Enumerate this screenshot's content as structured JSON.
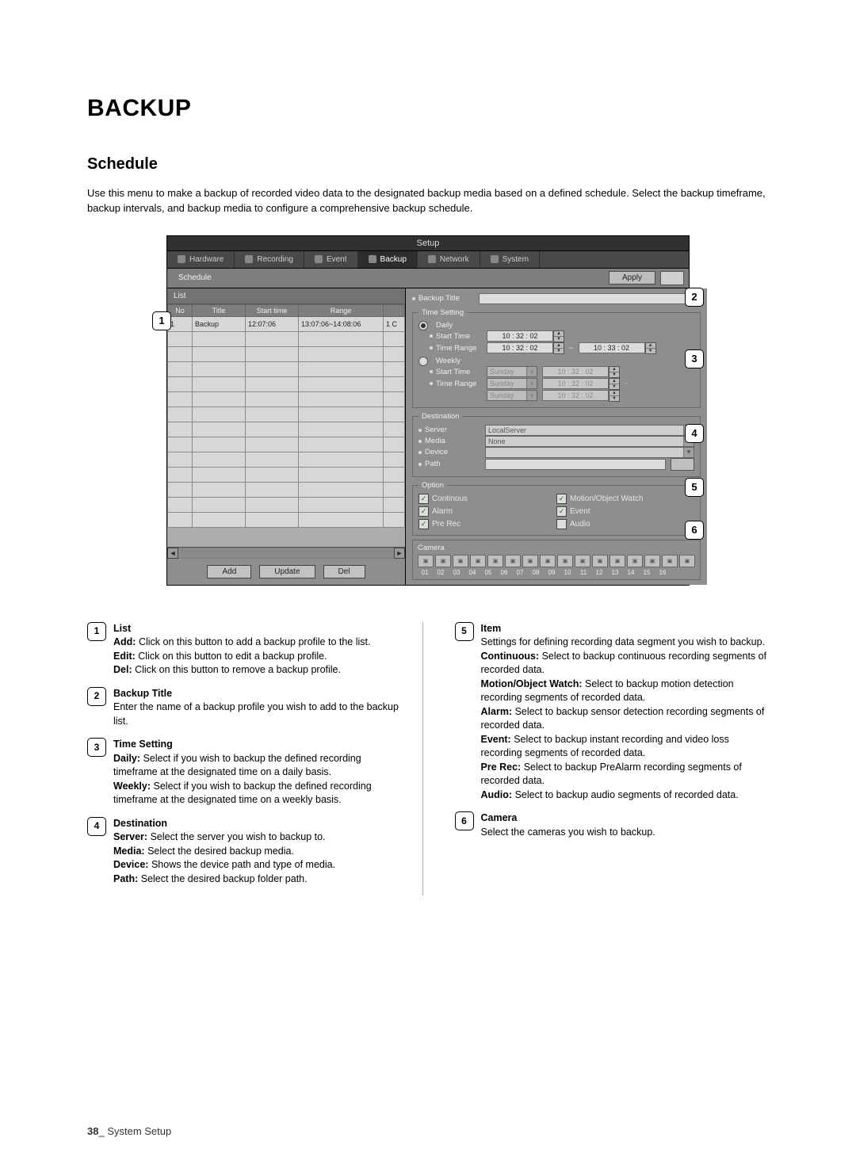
{
  "heading": "BACKUP",
  "section": "Schedule",
  "intro": "Use this menu to make a backup of recorded video data to the designated backup media based on a defined schedule. Select the backup timeframe, backup intervals, and backup media to configure a comprehensive backup schedule.",
  "footer_page": "38",
  "footer_label": "System Setup",
  "shot": {
    "title": "Setup",
    "tabs": [
      "Hardware",
      "Recording",
      "Event",
      "Backup",
      "Network",
      "System"
    ],
    "active_tab": "Backup",
    "subnav": "Schedule",
    "apply": "Apply",
    "list_header": "List",
    "list_cols": [
      "No",
      "Title",
      "Start time",
      "Range",
      ""
    ],
    "list_row": {
      "no": "1",
      "title": "Backup",
      "start": "12:07:06",
      "range": "13:07:06~14:08:06",
      "trail": "1 C"
    },
    "list_buttons": {
      "add": "Add",
      "update": "Update",
      "del": "Del"
    },
    "backup_title_label": "Backup Title",
    "time_setting": {
      "legend": "Time Setting",
      "daily_label": "Daily",
      "weekly_label": "Weekly",
      "start_label": "Start Time",
      "range_label": "Time Range",
      "daily_start": "10 : 32 : 02",
      "daily_range_from": "10 : 32 : 02",
      "daily_range_to": "10 : 33 : 02",
      "weekly_day": "Sunday",
      "weekly_start": "10 : 32 : 02",
      "weekly_range_day1": "Sunday",
      "weekly_range_t1": "10 : 32 : 02",
      "weekly_range_day2": "Sunday",
      "weekly_range_t2": "10 : 32 : 02"
    },
    "destination": {
      "legend": "Destination",
      "server_label": "Server",
      "server_value": "LocalServer",
      "media_label": "Media",
      "media_value": "None",
      "device_label": "Device",
      "path_label": "Path"
    },
    "option": {
      "legend": "Option",
      "continous": "Continous",
      "motion": "Motion/Object Watch",
      "alarm": "Alarm",
      "event": "Event",
      "prerec": "Pre Rec",
      "audio": "Audio"
    },
    "camera": {
      "legend": "Camera",
      "nums": [
        "01",
        "02",
        "03",
        "04",
        "05",
        "06",
        "07",
        "08",
        "09",
        "10",
        "11",
        "12",
        "13",
        "14",
        "15",
        "16"
      ]
    }
  },
  "desc": {
    "b1": {
      "title": "List",
      "add_k": "Add:",
      "add_v": "Click on this button to add a backup profile to the list.",
      "edit_k": "Edit:",
      "edit_v": "Click on this button to edit a backup profile.",
      "del_k": "Del:",
      "del_v": "Click on this button to remove a backup profile."
    },
    "b2": {
      "title": "Backup Title",
      "text": "Enter the name of a backup profile you wish to add to the backup list."
    },
    "b3": {
      "title": "Time Setting",
      "daily_k": "Daily:",
      "daily_v": "Select if you wish to backup the defined recording timeframe at the designated time on a daily basis.",
      "weekly_k": "Weekly:",
      "weekly_v": "Select if you wish to backup the defined recording timeframe at the designated time on a weekly basis."
    },
    "b4": {
      "title": "Destination",
      "server_k": "Server:",
      "server_v": "Select the server you wish to backup to.",
      "media_k": "Media:",
      "media_v": "Select the desired backup media.",
      "device_k": "Device:",
      "device_v": "Shows the device path and type of media.",
      "path_k": "Path:",
      "path_v": "Select the desired backup folder path."
    },
    "b5": {
      "title": "Item",
      "intro": "Settings for defining recording data segment you wish to backup.",
      "cont_k": "Continuous:",
      "cont_v": "Select to backup continuous recording segments of recorded data.",
      "mow_k": "Motion/Object Watch:",
      "mow_v": "Select to backup motion detection recording segments of recorded data.",
      "alarm_k": "Alarm:",
      "alarm_v": "Select to backup sensor detection recording segments of recorded data.",
      "event_k": "Event:",
      "event_v": "Select to backup instant recording and video loss recording segments of recorded data.",
      "pre_k": "Pre Rec:",
      "pre_v": "Select to backup PreAlarm recording segments of recorded data.",
      "audio_k": "Audio:",
      "audio_v": "Select to backup audio segments of recorded data."
    },
    "b6": {
      "title": "Camera",
      "text": "Select the cameras you wish to backup."
    }
  }
}
